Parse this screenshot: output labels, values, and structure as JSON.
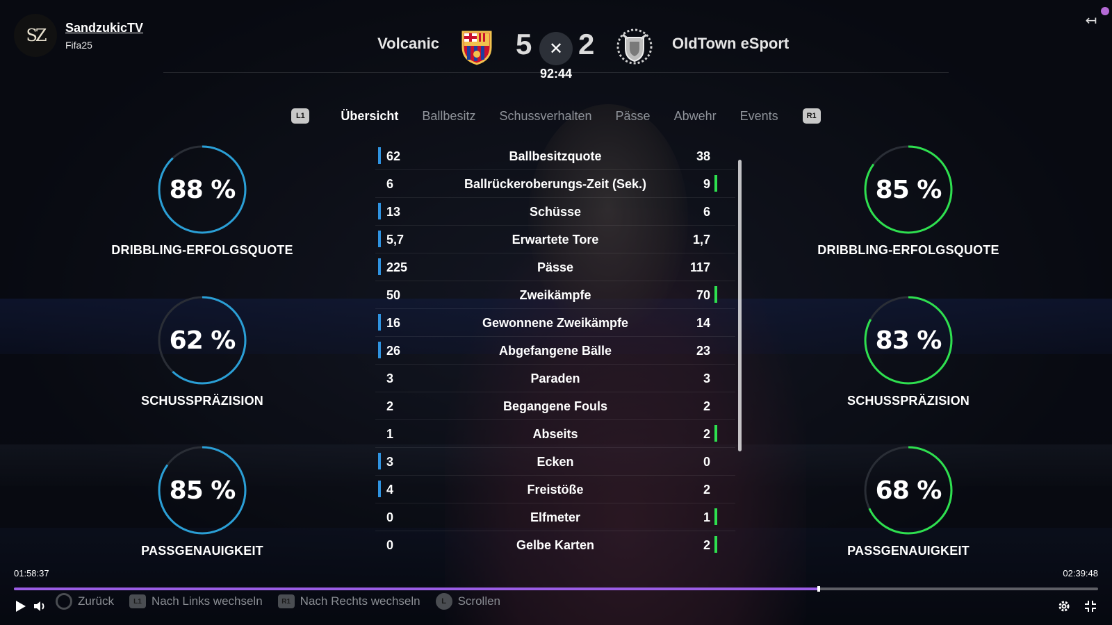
{
  "channel": {
    "avatar_text": "SZ",
    "name": "SandzukicTV",
    "subtitle": "Fifa25"
  },
  "match": {
    "home_team": "Volcanic",
    "away_team": "OldTown eSport",
    "home_score": "5",
    "away_score": "2",
    "close_glyph": "✕",
    "clock": "92:44"
  },
  "tabs": {
    "left_shoulder": "L1",
    "right_shoulder": "R1",
    "items": [
      "Übersicht",
      "Ballbesitz",
      "Schussverhalten",
      "Pässe",
      "Abwehr",
      "Events"
    ],
    "active": "Übersicht"
  },
  "ring_stats": {
    "home": [
      {
        "value": 88,
        "display": "88 %",
        "label": "DRIBBLING-ERFOLGSQUOTE"
      },
      {
        "value": 62,
        "display": "62 %",
        "label": "SCHUSSPRÄZISION"
      },
      {
        "value": 85,
        "display": "85 %",
        "label": "PASSGENAUIGKEIT"
      }
    ],
    "away": [
      {
        "value": 85,
        "display": "85 %",
        "label": "DRIBBLING-ERFOLGSQUOTE"
      },
      {
        "value": 83,
        "display": "83 %",
        "label": "SCHUSSPRÄZISION"
      },
      {
        "value": 68,
        "display": "68 %",
        "label": "PASSGENAUIGKEIT"
      }
    ],
    "home_color": "#2a9fd6",
    "away_color": "#2ee04f",
    "track_color": "#2a2e36"
  },
  "stats": [
    {
      "label": "Ballbesitzquote",
      "home": "62",
      "away": "38",
      "leader": "home"
    },
    {
      "label": "Ballrückeroberungs-Zeit (Sek.)",
      "home": "6",
      "away": "9",
      "leader": "away"
    },
    {
      "label": "Schüsse",
      "home": "13",
      "away": "6",
      "leader": "home"
    },
    {
      "label": "Erwartete Tore",
      "home": "5,7",
      "away": "1,7",
      "leader": "home"
    },
    {
      "label": "Pässe",
      "home": "225",
      "away": "117",
      "leader": "home"
    },
    {
      "label": "Zweikämpfe",
      "home": "50",
      "away": "70",
      "leader": "away"
    },
    {
      "label": "Gewonnene Zweikämpfe",
      "home": "16",
      "away": "14",
      "leader": "home"
    },
    {
      "label": "Abgefangene Bälle",
      "home": "26",
      "away": "23",
      "leader": "home"
    },
    {
      "label": "Paraden",
      "home": "3",
      "away": "3",
      "leader": "none"
    },
    {
      "label": "Begangene Fouls",
      "home": "2",
      "away": "2",
      "leader": "none"
    },
    {
      "label": "Abseits",
      "home": "1",
      "away": "2",
      "leader": "away"
    },
    {
      "label": "Ecken",
      "home": "3",
      "away": "0",
      "leader": "home"
    },
    {
      "label": "Freistöße",
      "home": "4",
      "away": "2",
      "leader": "home"
    },
    {
      "label": "Elfmeter",
      "home": "0",
      "away": "1",
      "leader": "away"
    },
    {
      "label": "Gelbe Karten",
      "home": "0",
      "away": "2",
      "leader": "away"
    }
  ],
  "player": {
    "current_time": "01:58:37",
    "total_time": "02:39:48",
    "progress": 0.742,
    "progress_color": "#9b5de5"
  },
  "hints": [
    {
      "button": "",
      "type": "circle",
      "label": "Zurück"
    },
    {
      "button": "L1",
      "type": "shoulder",
      "label": "Nach Links wechseln"
    },
    {
      "button": "R1",
      "type": "shoulder",
      "label": "Nach Rechts wechseln"
    },
    {
      "button": "L",
      "type": "stick",
      "label": "Scrollen"
    }
  ],
  "icons": {
    "exit": "exit-arrow-icon",
    "play": "play-icon",
    "volume": "volume-icon",
    "settings": "gear-icon",
    "fullscreen": "exit-fullscreen-icon"
  }
}
